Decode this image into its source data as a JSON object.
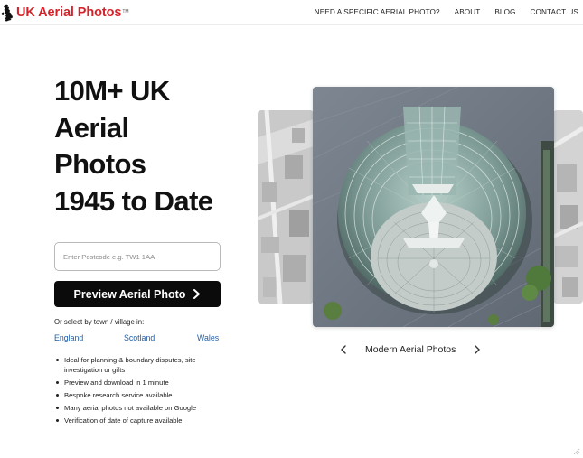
{
  "header": {
    "logo_text": "UK Aerial Photos",
    "logo_tm": "TM",
    "nav": [
      {
        "label": "NEED A SPECIFIC AERIAL PHOTO?"
      },
      {
        "label": "ABOUT"
      },
      {
        "label": "BLOG"
      },
      {
        "label": "CONTACT US"
      }
    ]
  },
  "hero": {
    "title_lines": [
      "10M+ UK",
      "Aerial",
      "Photos",
      "1945 to Date"
    ]
  },
  "search": {
    "placeholder": "Enter Postcode e.g. TW1 1AA",
    "value": "",
    "button_label": "Preview Aerial Photo"
  },
  "regions": {
    "label": "Or select by town / village in:",
    "items": [
      {
        "label": "England"
      },
      {
        "label": "Scotland"
      },
      {
        "label": "Wales"
      }
    ]
  },
  "features": [
    "Ideal for planning & boundary disputes, site investigation or gifts",
    "Preview and download in 1 minute",
    "Bespoke research service available",
    "Many aerial photos not available on Google",
    "Verification of date of capture available"
  ],
  "carousel": {
    "caption": "Modern Aerial Photos"
  },
  "colors": {
    "brand_red": "#d3242b",
    "button_black": "#0b0b0b",
    "link_blue": "#1f5ea8"
  },
  "icons": {
    "logo": "uk-map-icon",
    "button": "chevron-right-icon",
    "carousel_prev": "chevron-left-icon",
    "carousel_next": "chevron-right-icon"
  }
}
